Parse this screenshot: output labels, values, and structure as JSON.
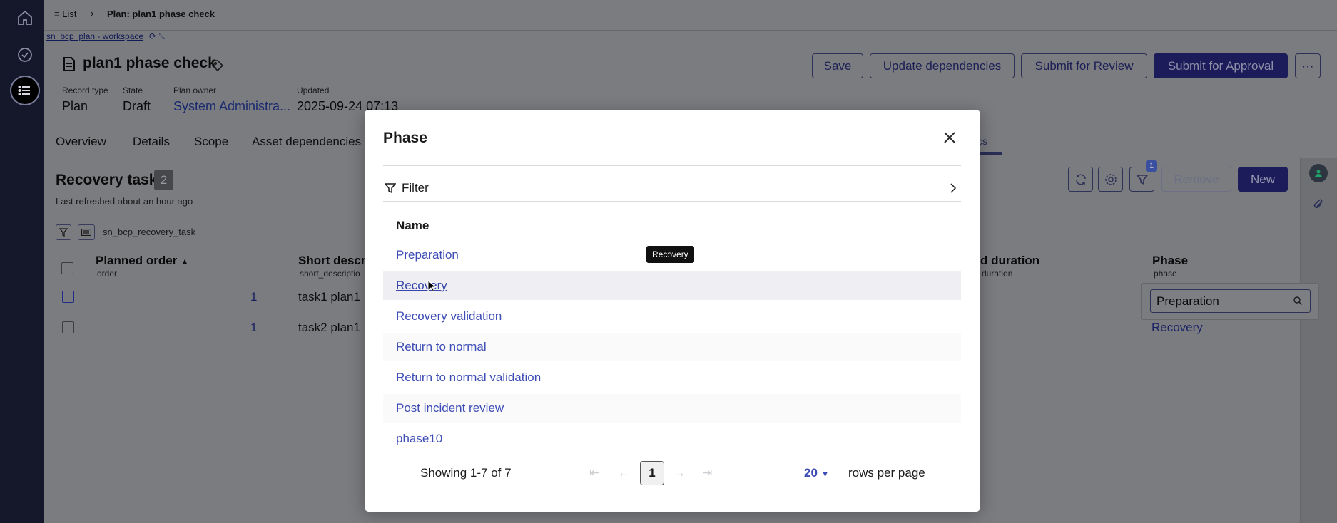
{
  "breadcrumb": {
    "list_label": "List",
    "current": "Plan: plan1 phase check",
    "workspace_link": "sn_bcp_plan - workspace"
  },
  "record": {
    "title": "plan1 phase check",
    "fields": [
      {
        "label": "Record type",
        "value": "Plan"
      },
      {
        "label": "State",
        "value": "Draft"
      },
      {
        "label": "Plan owner",
        "value": "System Administra..."
      },
      {
        "label": "Updated",
        "value": "2025-09-24 07:13"
      }
    ]
  },
  "actions": {
    "save": "Save",
    "update_dependencies": "Update dependencies",
    "submit_review": "Submit for Review",
    "submit_approval": "Submit for Approval",
    "more": "···"
  },
  "tabs": [
    "Overview",
    "Details",
    "Scope",
    "Asset dependencies",
    "cs"
  ],
  "related_list": {
    "title": "Recovery task",
    "count": "2",
    "refreshed": "Last refreshed about an hour ago",
    "table_name": "sn_bcp_recovery_task",
    "filter_badge": "1",
    "remove_label": "Remove",
    "new_label": "New",
    "columns": [
      {
        "label": "Planned order",
        "sub": "order"
      },
      {
        "label": "Short descri",
        "sub": "short_descriptio"
      },
      {
        "label": "d duration",
        "sub": "duration"
      },
      {
        "label": "Phase",
        "sub": "phase"
      }
    ],
    "rows": [
      {
        "order": "1",
        "short": "task1 plan1",
        "phase": "Preparation"
      },
      {
        "order": "1",
        "short": "task2 plan1",
        "phase": "Recovery"
      }
    ]
  },
  "modal": {
    "title": "Phase",
    "filter_label": "Filter",
    "column_header": "Name",
    "items": [
      "Preparation",
      "Recovery",
      "Recovery validation",
      "Return to normal",
      "Return to normal validation",
      "Post incident review",
      "phase10"
    ],
    "tooltip": "Recovery",
    "showing": "Showing 1-7 of 7",
    "current_page": "1",
    "rows_per_page_value": "20",
    "rows_per_page_label": "rows per page"
  },
  "colors": {
    "accent": "#3d4db5",
    "primary_button": "#1c1c5a"
  }
}
